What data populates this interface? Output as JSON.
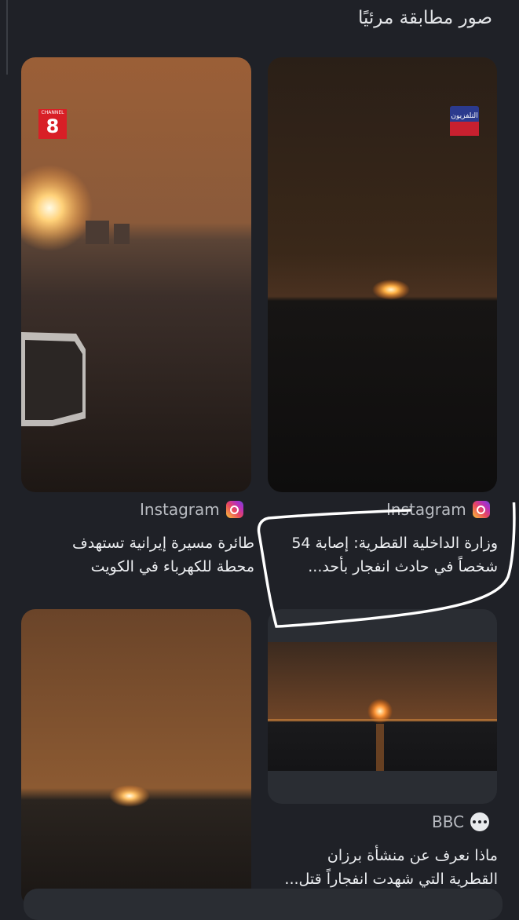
{
  "section": {
    "title": "صور مطابقة مرئيًا"
  },
  "results": [
    {
      "source": "Instagram",
      "source_icon": "instagram-icon",
      "caption_line1": "وزارة الداخلية القطرية: إصابة 54",
      "caption_line2": "شخصاً في حادث انفجار بأحد...",
      "logo_text": "التلفزيون"
    },
    {
      "source": "Instagram",
      "source_icon": "instagram-icon",
      "caption_line1": "طائرة مسيرة إيرانية تستهدف",
      "caption_line2": "محطة للكهرباء في الكويت",
      "logo_text": "8",
      "logo_small": "CHANNEL"
    },
    {
      "source": "BBC",
      "source_icon": "more-dots-icon",
      "caption_line1": "ماذا نعرف عن منشأة برزان",
      "caption_line2": "القطرية التي شهدت انفجاراً قتل..."
    },
    {
      "source": "",
      "caption_line1": "",
      "caption_line2": ""
    }
  ],
  "colors": {
    "background": "#1f2127",
    "text": "#eceef1",
    "muted": "#b9bcc2",
    "highlight_stroke": "#ffffff",
    "fire": "#ffb347"
  }
}
